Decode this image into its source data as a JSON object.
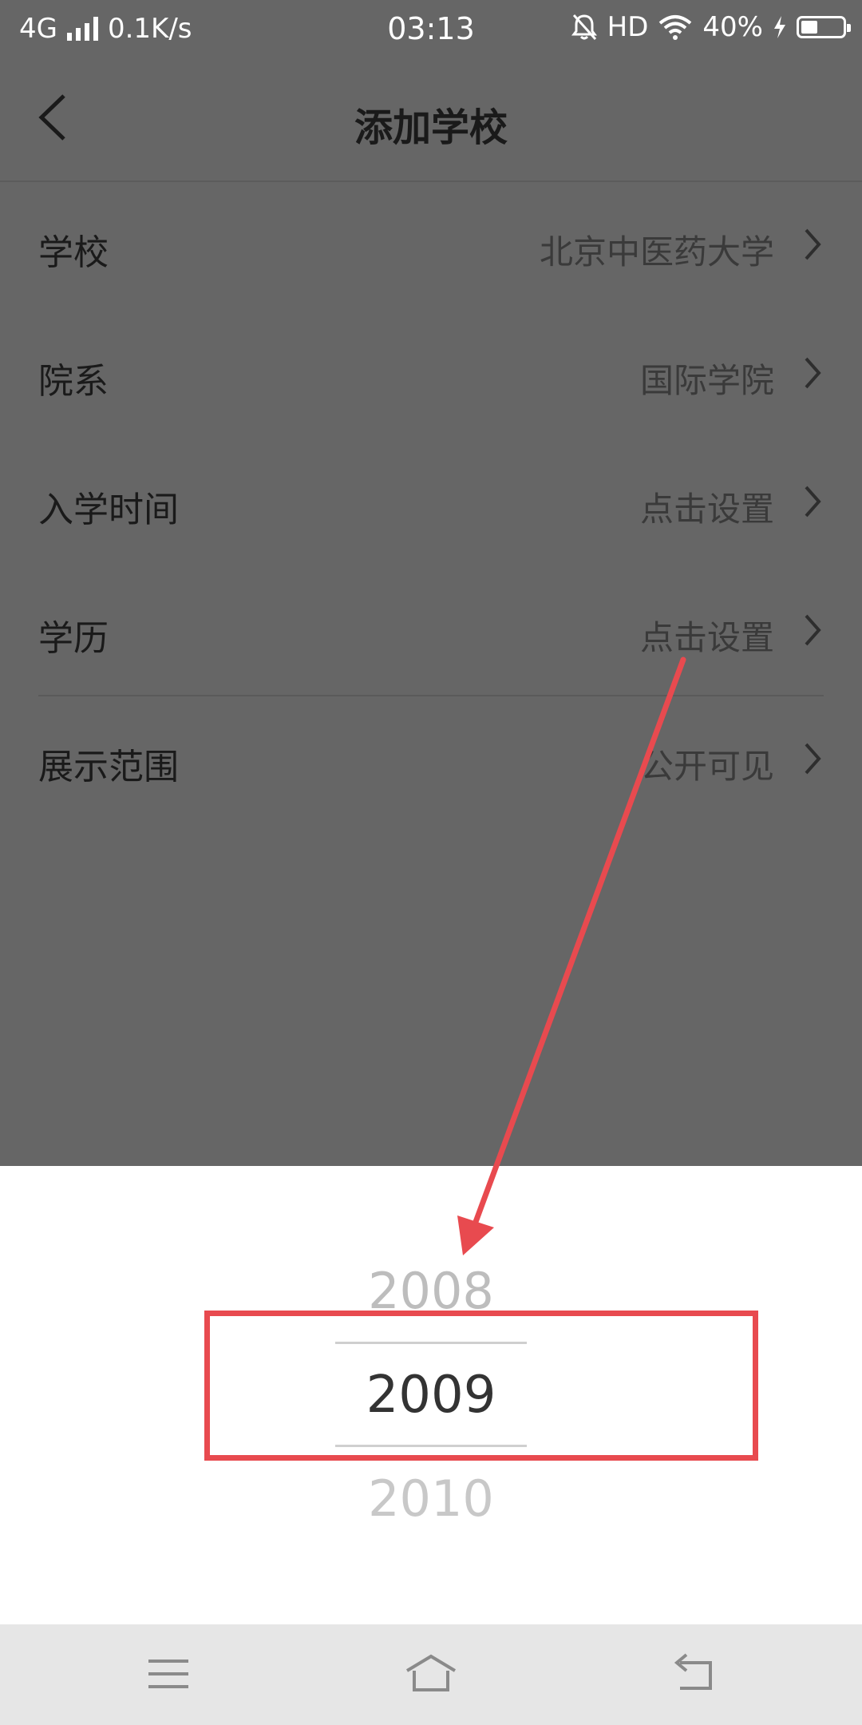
{
  "status_bar": {
    "network": "4G",
    "speed": "0.1K/s",
    "time": "03:13",
    "hd": "HD",
    "battery": "40%",
    "battery_level": 0.4
  },
  "header": {
    "title": "添加学校"
  },
  "rows": [
    {
      "label": "学校",
      "value": "北京中医药大学"
    },
    {
      "label": "院系",
      "value": "国际学院"
    },
    {
      "label": "入学时间",
      "value": "点击设置"
    },
    {
      "label": "学历",
      "value": "点击设置"
    },
    {
      "label": "展示范围",
      "value": "公开可见"
    }
  ],
  "picker": {
    "prev": "2008",
    "current": "2009",
    "next": "2010"
  },
  "colors": {
    "overlay": "#666666",
    "annotation": "#e84a4f",
    "navbar": "#e6e6e6"
  }
}
